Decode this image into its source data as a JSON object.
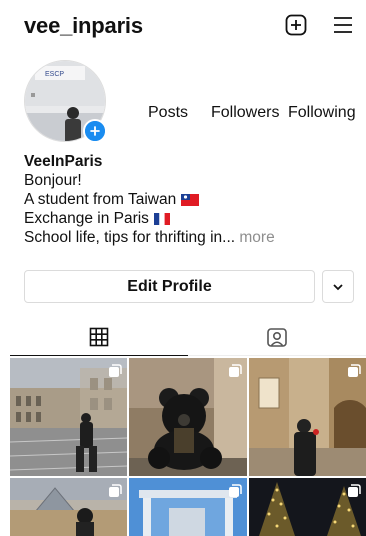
{
  "header": {
    "username": "vee_inparis",
    "create_icon": "plus-square-icon",
    "menu_icon": "hamburger-menu-icon"
  },
  "profile": {
    "avatar_badge_icon": "add-story-plus-icon",
    "stats": {
      "posts_label": "Posts",
      "followers_label": "Followers",
      "following_label": "Following"
    }
  },
  "bio": {
    "display_name": "VeeInParis",
    "line1": "Bonjour!",
    "line2": "A student from Taiwan",
    "line3": "Exchange in Paris",
    "line4": "School life, tips for thrifting in...",
    "more_label": "more"
  },
  "actions": {
    "edit_profile_label": "Edit Profile",
    "dropdown_icon": "chevron-down-icon"
  },
  "tabs": [
    {
      "name": "grid",
      "icon": "grid-icon",
      "active": true
    },
    {
      "name": "tagged",
      "icon": "tagged-person-icon",
      "active": false
    }
  ],
  "colors": {
    "accent": "#1a8cf0",
    "muted": "#8e8e8e",
    "border": "#dbdbdb"
  }
}
